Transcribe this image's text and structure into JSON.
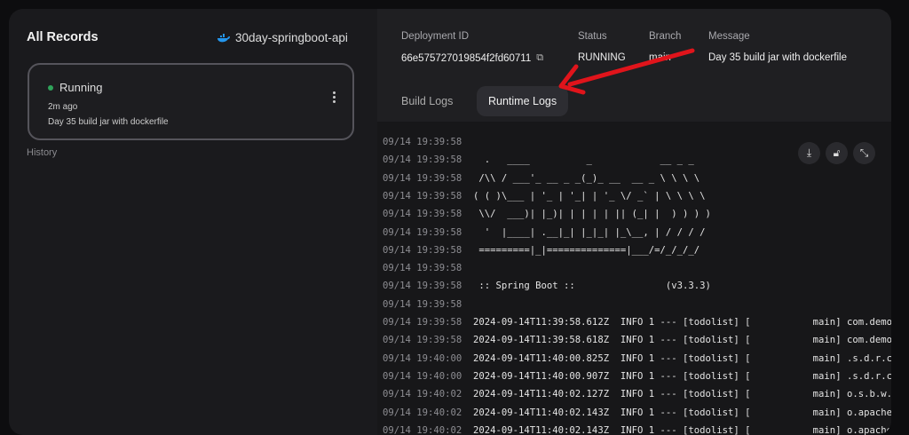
{
  "left": {
    "title": "All Records",
    "project": "30day-springboot-api",
    "card": {
      "status": "Running",
      "ago": "2m ago",
      "message": "Day 35 build jar with dockerfile"
    },
    "history": "History"
  },
  "details": {
    "id_label": "Deployment ID",
    "id": "66e575727019854f2fd60711",
    "status_label": "Status",
    "status": "RUNNING",
    "branch_label": "Branch",
    "branch": "main",
    "message_label": "Message",
    "message": "Day 35 build jar with dockerfile"
  },
  "tabs": [
    "Build Logs",
    "Runtime Logs"
  ],
  "colors": {
    "running": "#2fa35a",
    "annotation_arrow": "#e0141b"
  },
  "logs": [
    {
      "t": "09/14 19:39:58",
      "m": ""
    },
    {
      "t": "09/14 19:39:58",
      "m": "  .   ____          _            __ _ _"
    },
    {
      "t": "09/14 19:39:58",
      "m": " /\\\\ / ___'_ __ _ _(_)_ __  __ _ \\ \\ \\ \\"
    },
    {
      "t": "09/14 19:39:58",
      "m": "( ( )\\___ | '_ | '_| | '_ \\/ _` | \\ \\ \\ \\"
    },
    {
      "t": "09/14 19:39:58",
      "m": " \\\\/  ___)| |_)| | | | | || (_| |  ) ) ) )"
    },
    {
      "t": "09/14 19:39:58",
      "m": "  '  |____| .__|_| |_|_| |_\\__, | / / / /"
    },
    {
      "t": "09/14 19:39:58",
      "m": " =========|_|==============|___/=/_/_/_/"
    },
    {
      "t": "09/14 19:39:58",
      "m": ""
    },
    {
      "t": "09/14 19:39:58",
      "m": " :: Spring Boot ::                (v3.3.3)"
    },
    {
      "t": "09/14 19:39:58",
      "m": ""
    },
    {
      "t": "09/14 19:39:58",
      "m": "2024-09-14T11:39:58.612Z  INFO 1 --- [todolist] [           main] com.demo."
    },
    {
      "t": "09/14 19:39:58",
      "m": "2024-09-14T11:39:58.618Z  INFO 1 --- [todolist] [           main] com.demo."
    },
    {
      "t": "09/14 19:40:00",
      "m": "2024-09-14T11:40:00.825Z  INFO 1 --- [todolist] [           main] .s.d.r.c."
    },
    {
      "t": "09/14 19:40:00",
      "m": "2024-09-14T11:40:00.907Z  INFO 1 --- [todolist] [           main] .s.d.r.c."
    },
    {
      "t": "09/14 19:40:02",
      "m": "2024-09-14T11:40:02.127Z  INFO 1 --- [todolist] [           main] o.s.b.w.e"
    },
    {
      "t": "09/14 19:40:02",
      "m": "2024-09-14T11:40:02.143Z  INFO 1 --- [todolist] [           main] o.apache."
    },
    {
      "t": "09/14 19:40:02",
      "m": "2024-09-14T11:40:02.143Z  INFO 1 --- [todolist] [           main] o.apache."
    }
  ]
}
